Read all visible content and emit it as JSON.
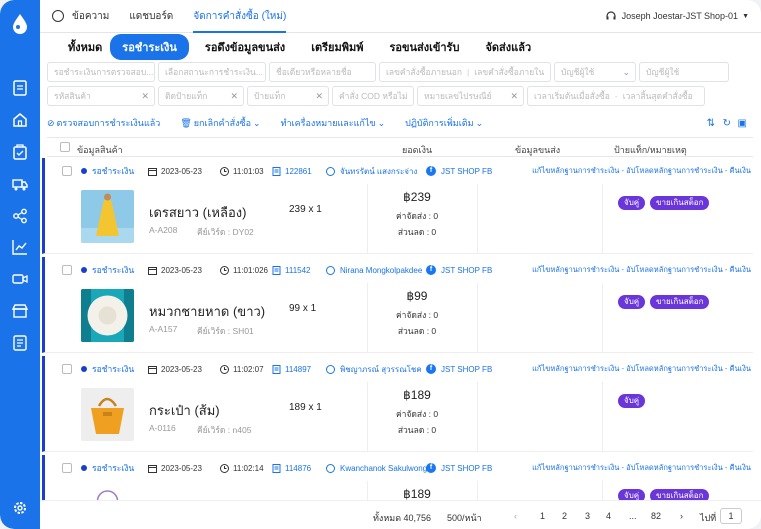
{
  "topbar": {
    "tabs": [
      {
        "label": "ข้อความ"
      },
      {
        "label": "แดชบอร์ด"
      },
      {
        "label": "จัดการคำสั่งซื้อ (ใหม่)"
      }
    ],
    "user": "Joseph Joestar-JST Shop-01"
  },
  "status_tabs": [
    "ทั้งหมด",
    "รอชำระเงิน",
    "รอดึงข้อมูลขนส่ง",
    "เตรียมพิมพ์",
    "รอขนส่งเข้ารับ",
    "จัดส่งแล้ว"
  ],
  "filters": {
    "row1": [
      "รอชำระเงินการตรวจสอบ...",
      "เลือกสถานะการชำระเงิน...",
      "ชื่อเดียวหรือหลายชื่อ",
      "เลขคำสั่งซื้อภายนอก",
      "เลขคำสั่งซื้อภายใน",
      "บัญชีผู้ใช้",
      "บัญชีผู้ใช้"
    ],
    "row2": [
      "รหัสสินค้า",
      "ติดป้ายแท็ก",
      "ป้ายแท็ก",
      "คำสั่ง COD หรือไม่",
      "หมายเลขไปรษณีย์",
      "เวลาเริ่มต้นเมื่อสั่งซื้อ",
      "เวลาสิ้นสุดคำสั่งซื้อ"
    ]
  },
  "actions": [
    "ตรวจสอบการชำระเงินแล้ว",
    "ยกเลิกคำสั่งซื้อ",
    "ทำเครื่องหมายและแก้ไข",
    "ปฏิบัติการเพิ่มเติม"
  ],
  "columns": {
    "product": "ข้อมูลสินค้า",
    "amount": "ยอดเงิน",
    "shipping": "ข้อมูลขนส่ง",
    "tags": "ป้ายแท็ก/หมายเหตุ"
  },
  "orders": [
    {
      "status": "รอชำระเงิน",
      "date": "2023-05-23",
      "time": "11:01:03",
      "order_no": "122861",
      "customer": "จันทรรัตน์ แสงกระจ่าง",
      "shop": "JST SHOP FB",
      "links": "แก้ไขหลักฐานการชำระเงิน - อัปโหลดหลักฐานการชำระเงิน - คืนเงิน",
      "name": "เดรสยาว (เหลือง)",
      "qty": "239 x 1",
      "sku": "A-A208",
      "key": "คีย์เวิร์ด : DY02",
      "price": "฿239",
      "fee": "ค่าจัดส่ง : 0",
      "discount": "ส่วนลด : 0",
      "tags": [
        "จับคู่",
        "ขายเกินสต็อก"
      ]
    },
    {
      "status": "รอชำระเงิน",
      "date": "2023-05-23",
      "time": "11:01:026",
      "order_no": "111542",
      "customer": "Nirana Mongkolpakdee",
      "shop": "JST SHOP FB",
      "links": "แก้ไขหลักฐานการชำระเงิน - อัปโหลดหลักฐานการชำระเงิน - คืนเงิน",
      "name": "หมวกชายหาด (ขาว)",
      "qty": "99 x 1",
      "sku": "A-A157",
      "key": "คีย์เวิร์ด : SH01",
      "price": "฿99",
      "fee": "ค่าจัดส่ง : 0",
      "discount": "ส่วนลด : 0",
      "tags": [
        "จับคู่",
        "ขายเกินสต็อก"
      ]
    },
    {
      "status": "รอชำระเงิน",
      "date": "2023-05-23",
      "time": "11:02:07",
      "order_no": "114897",
      "customer": "พิชญาภรณ์ สุวรรณโชค",
      "shop": "JST SHOP FB",
      "links": "แก้ไขหลักฐานการชำระเงิน - อัปโหลดหลักฐานการชำระเงิน - คืนเงิน",
      "name": "กระเป๋า (ส้ม)",
      "qty": "189 x 1",
      "sku": "A-0116",
      "key": "คีย์เวิร์ด : n405",
      "price": "฿189",
      "fee": "ค่าจัดส่ง : 0",
      "discount": "ส่วนลด : 0",
      "tags": [
        "จับคู่"
      ]
    },
    {
      "status": "รอชำระเงิน",
      "date": "2023-05-23",
      "time": "11:02:14",
      "order_no": "114876",
      "customer": "Kwanchanok Sakulwong",
      "shop": "JST SHOP FB",
      "links": "แก้ไขหลักฐานการชำระเงิน - อัปโหลดหลักฐานการชำระเงิน - คืนเงิน",
      "name": "",
      "qty": "",
      "sku": "",
      "key": "",
      "price": "฿189",
      "fee": "",
      "discount": "",
      "tags": [
        "จับคู่",
        "ขายเกินสต็อก"
      ]
    }
  ],
  "footer": {
    "total": "ทั้งหมด 40,756",
    "per_page": "500/หน้า",
    "pages": [
      "1",
      "2",
      "3",
      "4",
      "...",
      "82"
    ],
    "goto": "ไปที่",
    "page_input": "1"
  },
  "colors": {
    "primary": "#1a73e8",
    "tag": "#6a35d9",
    "accent_bar": "#1a3fcf"
  }
}
